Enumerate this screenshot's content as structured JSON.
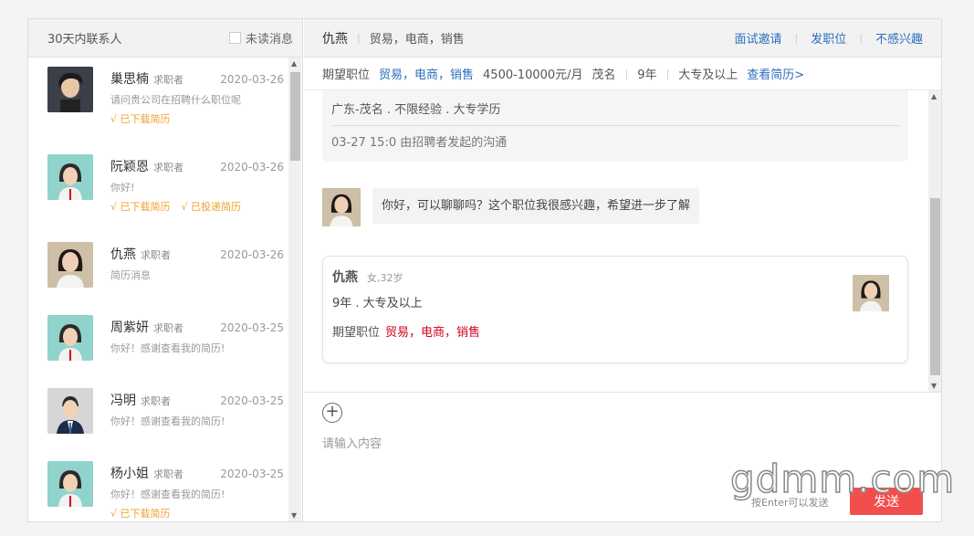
{
  "sidebar": {
    "title": "30天内联系人",
    "unread_label": "未读消息",
    "contacts": [
      {
        "name": "巢思楠",
        "role": "求职者",
        "date": "2020-03-26",
        "preview": "请问贵公司在招聘什么职位呢",
        "tags": [
          "√ 已下载简历"
        ],
        "avatar": "male-photo-avatar"
      },
      {
        "name": "阮颖恩",
        "role": "求职者",
        "date": "2020-03-26",
        "preview": "你好!",
        "tags": [
          "√ 已下载简历",
          "√ 已投递简历"
        ],
        "avatar": "female-default-avatar"
      },
      {
        "name": "仇燕",
        "role": "求职者",
        "date": "2020-03-26",
        "preview": "简历消息",
        "tags": [],
        "avatar": "female-photo-avatar"
      },
      {
        "name": "周紫妍",
        "role": "求职者",
        "date": "2020-03-25",
        "preview": "你好！感谢查看我的简历!",
        "tags": [],
        "avatar": "female-default-avatar"
      },
      {
        "name": "冯明",
        "role": "求职者",
        "date": "2020-03-25",
        "preview": "你好！感谢查看我的简历!",
        "tags": [],
        "avatar": "male-default-avatar"
      },
      {
        "name": "杨小姐",
        "role": "求职者",
        "date": "2020-03-25",
        "preview": "你好！感谢查看我的简历!",
        "tags": [
          "√ 已下载简历"
        ],
        "avatar": "female-default-avatar"
      }
    ]
  },
  "header": {
    "name": "仇燕",
    "positions": "贸易，电商，销售",
    "actions": [
      "面试邀请",
      "发职位",
      "不感兴趣"
    ]
  },
  "expectation": {
    "label": "期望职位",
    "positions": "贸易，电商，销售",
    "salary": "4500-10000元/月",
    "city": "茂名",
    "experience": "9年",
    "education": "大专及以上",
    "view_resume": "查看简历>"
  },
  "chat": {
    "job_card_line": "广东-茂名 . 不限经验 . 大专学历",
    "job_card_meta": "03-27 15:0 由招聘者发起的沟通",
    "message": "你好，可以聊聊吗？这个职位我很感兴趣，希望进一步了解",
    "resume_card": {
      "name": "仇燕",
      "meta": "女,32岁",
      "summary": "9年 . 大专及以上",
      "label": "期望职位",
      "positions": "贸易，电商，销售"
    }
  },
  "compose": {
    "placeholder": "请输入内容",
    "hint": "按Enter可以发送",
    "send_label": "发送"
  },
  "watermark": "gdmm.com",
  "colors": {
    "accent_blue": "#2a6ebd",
    "send_red": "#f34e4e",
    "tag_orange": "#f0a030",
    "position_red": "#d0021b"
  }
}
